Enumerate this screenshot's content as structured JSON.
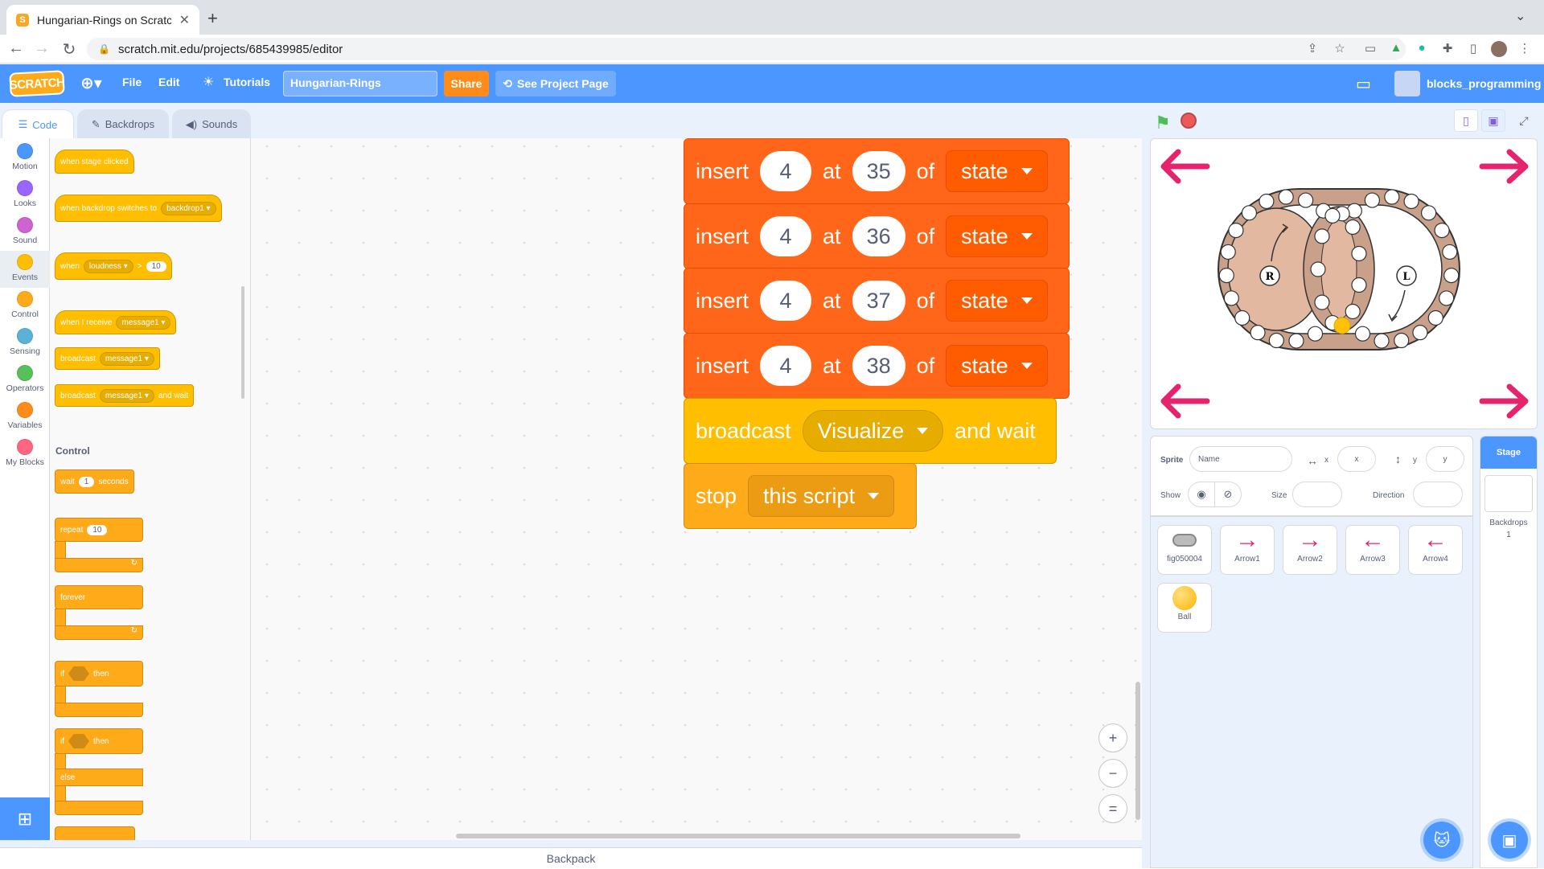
{
  "browser": {
    "tab_title": "Hungarian-Rings on Scratch",
    "url": "scratch.mit.edu/projects/685439985/editor"
  },
  "menubar": {
    "logo": "SCRATCH",
    "file": "File",
    "edit": "Edit",
    "tutorials": "Tutorials",
    "project_title": "Hungarian-Rings",
    "share": "Share",
    "see_project_page": "See Project Page",
    "username": "blocks_programming"
  },
  "editor_tabs": {
    "code": "Code",
    "backdrops": "Backdrops",
    "sounds": "Sounds"
  },
  "categories": [
    {
      "label": "Motion",
      "color": "#4c97ff"
    },
    {
      "label": "Looks",
      "color": "#9966ff"
    },
    {
      "label": "Sound",
      "color": "#cf63cf"
    },
    {
      "label": "Events",
      "color": "#ffbf00"
    },
    {
      "label": "Control",
      "color": "#ffab19"
    },
    {
      "label": "Sensing",
      "color": "#5cb1d6"
    },
    {
      "label": "Operators",
      "color": "#59c059"
    },
    {
      "label": "Variables",
      "color": "#ff8c1a"
    },
    {
      "label": "My Blocks",
      "color": "#ff6680"
    }
  ],
  "palette": {
    "when_stage_clicked": "when stage clicked",
    "when_backdrop_switches": "when backdrop switches to",
    "backdrop1": "backdrop1",
    "when": "when",
    "loudness": "loudness",
    "gt": ">",
    "ten": "10",
    "when_i_receive": "when I receive",
    "message1": "message1",
    "broadcast": "broadcast",
    "and_wait": "and wait",
    "control_heading": "Control",
    "wait": "wait",
    "one": "1",
    "seconds": "seconds",
    "repeat": "repeat",
    "forever": "forever",
    "if": "if",
    "then": "then",
    "else": "else"
  },
  "script": {
    "insert_blocks": [
      {
        "verb": "insert",
        "item": "4",
        "at": "at",
        "index": "35",
        "of": "of",
        "list": "state"
      },
      {
        "verb": "insert",
        "item": "4",
        "at": "at",
        "index": "36",
        "of": "of",
        "list": "state"
      },
      {
        "verb": "insert",
        "item": "4",
        "at": "at",
        "index": "37",
        "of": "of",
        "list": "state"
      },
      {
        "verb": "insert",
        "item": "4",
        "at": "at",
        "index": "38",
        "of": "of",
        "list": "state"
      }
    ],
    "broadcast": {
      "verb": "broadcast",
      "message": "Visualize",
      "suffix": "and wait"
    },
    "stop": {
      "verb": "stop",
      "option": "this script"
    }
  },
  "zoom": {
    "in": "+",
    "out": "−",
    "reset": "="
  },
  "backpack": "Backpack",
  "sprite_info": {
    "sprite_label": "Sprite",
    "name_placeholder": "Name",
    "x_label": "x",
    "x_placeholder": "x",
    "y_label": "y",
    "y_placeholder": "y",
    "show_label": "Show",
    "size_label": "Size",
    "direction_label": "Direction"
  },
  "sprites": [
    {
      "name": "fig050004",
      "icon": "toggle-icon"
    },
    {
      "name": "Arrow1",
      "icon": "arrow-right-icon",
      "glyph": "→"
    },
    {
      "name": "Arrow2",
      "icon": "arrow-right-icon",
      "glyph": "→"
    },
    {
      "name": "Arrow3",
      "icon": "arrow-left-icon",
      "glyph": "←"
    },
    {
      "name": "Arrow4",
      "icon": "arrow-left-icon",
      "glyph": "←"
    },
    {
      "name": "Ball",
      "icon": "ball-icon"
    }
  ],
  "stage_panel": {
    "header": "Stage",
    "backdrops_label": "Backdrops",
    "backdrops_count": "1"
  },
  "stage_view": {
    "left_ring_label": "R",
    "right_ring_label": "L",
    "arrow_color": "#e6246e",
    "ring_color": "#c8a088",
    "ring_fill": "#e2b9a0"
  }
}
